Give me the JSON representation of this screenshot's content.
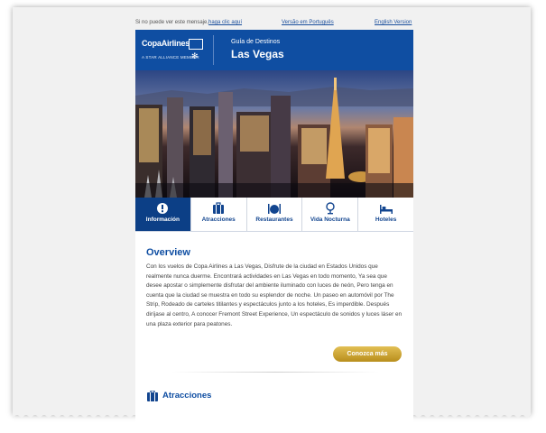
{
  "topbar": {
    "not_visible_text": "Si no puede ver este mensaje,",
    "click_here": "haga clic aquí",
    "portuguese_link": "Versão em Português",
    "english_link": "English Version"
  },
  "header": {
    "logo": "CopaAirlines",
    "logo_sub": "A STAR ALLIANCE MEMBER",
    "guide_label": "Guía de Destinos",
    "city": "Las Vegas"
  },
  "tabs": [
    {
      "label": "Información",
      "icon": "info-icon",
      "active": true
    },
    {
      "label": "Atracciones",
      "icon": "luggage-icon",
      "active": false
    },
    {
      "label": "Restaurantes",
      "icon": "utensils-icon",
      "active": false
    },
    {
      "label": "Vida Nocturna",
      "icon": "cocktail-icon",
      "active": false
    },
    {
      "label": "Hoteles",
      "icon": "bed-icon",
      "active": false
    }
  ],
  "overview": {
    "title": "Overview",
    "body": "Con los vuelos de Copa Airlines a Las Vegas, Disfrute de la ciudad en Estados Unidos que realmente nunca duerme. Encontrará actividades en Las Vegas en todo momento, Ya sea que desee apostar o simplemente disfrutar del ambiente iluminado con luces de neón, Pero tenga en cuenta que la ciudad se muestra en todo su esplendor de noche. Un paseo en automóvil por The Strip, Rodeado de carteles titilantes y espectáculos junto a los hoteles, Es imperdible. Después diríjase al centro, A conocer Fremont Street Experience, Un espectáculo de sonidos y luces láser en una plaza exterior para peatones.",
    "button": "Conozca más"
  },
  "next_section": {
    "title": "Atracciones"
  },
  "colors": {
    "brand_blue": "#0f4ea2",
    "active_tab": "#0c3f86",
    "button_gold": "#c89b2a"
  }
}
